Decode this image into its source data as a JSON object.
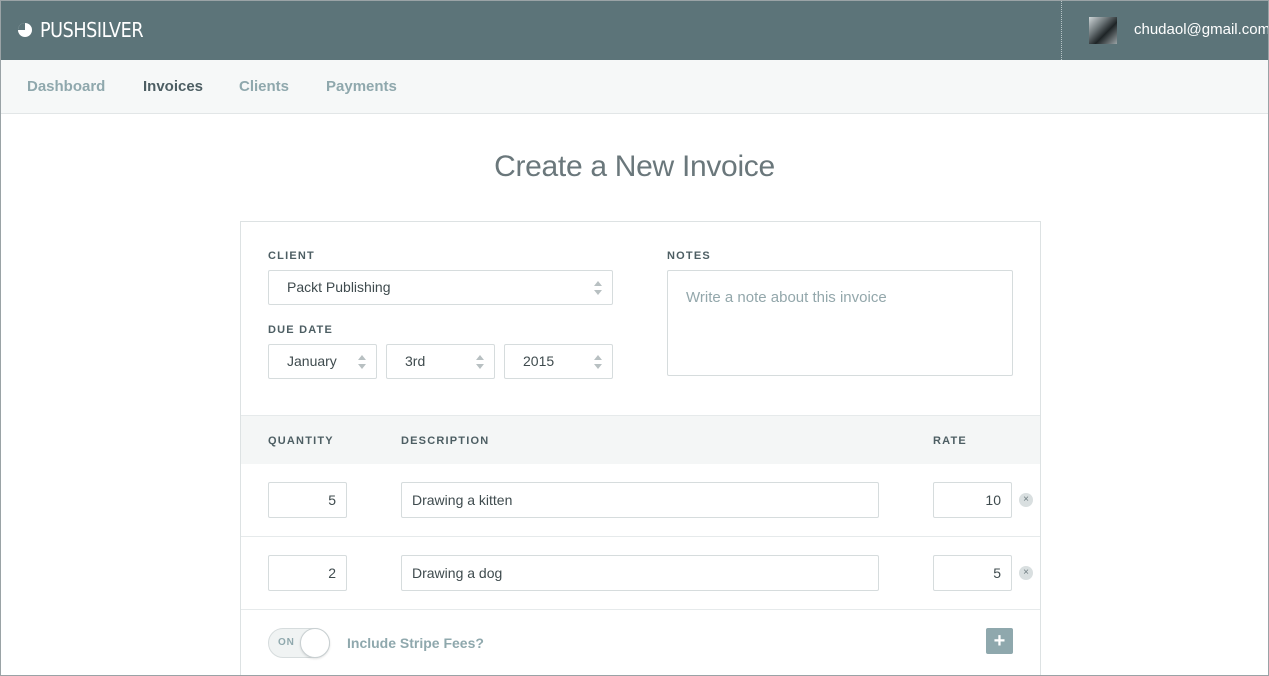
{
  "app": {
    "brand": "PUSHSILVER",
    "user_email": "chudaol@gmail.com"
  },
  "nav": {
    "items": [
      {
        "label": "Dashboard",
        "active": false
      },
      {
        "label": "Invoices",
        "active": true
      },
      {
        "label": "Clients",
        "active": false
      },
      {
        "label": "Payments",
        "active": false
      }
    ]
  },
  "page": {
    "title": "Create a New Invoice"
  },
  "form": {
    "client_label": "CLIENT",
    "client_value": "Packt Publishing",
    "due_date_label": "DUE DATE",
    "due_month": "January",
    "due_day": "3rd",
    "due_year": "2015",
    "notes_label": "NOTES",
    "notes_placeholder": "Write a note about this invoice",
    "notes_value": ""
  },
  "items_table": {
    "headers": {
      "quantity": "QUANTITY",
      "description": "DESCRIPTION",
      "rate": "RATE"
    },
    "rows": [
      {
        "quantity": "5",
        "description": "Drawing a kitten",
        "rate": "10"
      },
      {
        "quantity": "2",
        "description": "Drawing a dog",
        "rate": "5"
      }
    ],
    "remove_glyph": "×"
  },
  "footer": {
    "toggle_text": "ON",
    "stripe_label": "Include Stripe Fees?",
    "add_glyph": "+"
  },
  "icons": {
    "brand": "brand-logo-icon",
    "select_arrows": "select-arrows-icon",
    "remove": "remove-item-icon",
    "add": "plus-icon"
  },
  "colors": {
    "header_bg": "#5c7479",
    "accent": "#8fa8ad",
    "nav_bg": "#f6f8f8"
  }
}
